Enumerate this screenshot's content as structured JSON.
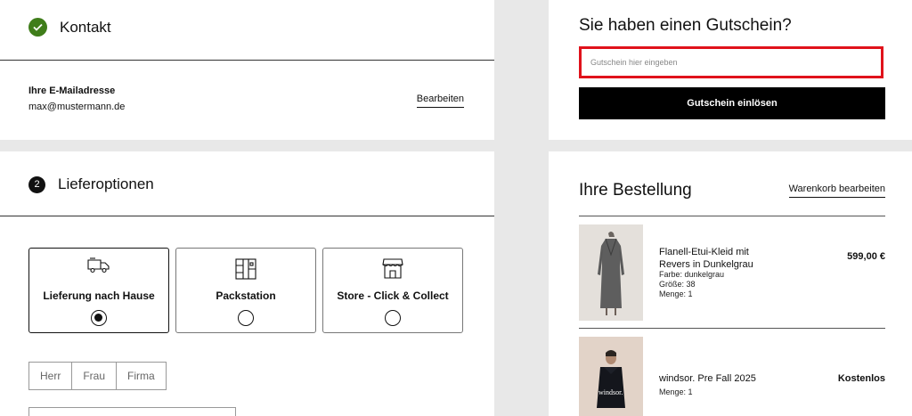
{
  "contact": {
    "title": "Kontakt",
    "email_label": "Ihre E-Mailadresse",
    "email_value": "max@mustermann.de",
    "edit_label": "Bearbeiten"
  },
  "delivery": {
    "step_number": "2",
    "title": "Lieferoptionen",
    "options": [
      {
        "label": "Lieferung nach Hause",
        "icon": "truck-icon",
        "selected": true
      },
      {
        "label": "Packstation",
        "icon": "packstation-icon",
        "selected": false
      },
      {
        "label": "Store - Click & Collect",
        "icon": "store-icon",
        "selected": false
      }
    ],
    "salutations": [
      "Herr",
      "Frau",
      "Firma"
    ]
  },
  "coupon": {
    "title": "Sie haben einen Gutschein?",
    "placeholder": "Gutschein hier eingeben",
    "button_label": "Gutschein einlösen",
    "highlight_color": "#e0121b"
  },
  "order": {
    "title": "Ihre Bestellung",
    "edit_cart_label": "Warenkorb bearbeiten",
    "items": [
      {
        "name": "Flanell-Etui-Kleid mit Revers in Dunkelgrau",
        "color": "Farbe: dunkelgrau",
        "size": "Größe:  38",
        "quantity": "Menge: 1",
        "price": "599,00 €"
      },
      {
        "name": "windsor. Pre Fall 2025",
        "quantity": "Menge: 1",
        "price": "Kostenlos",
        "image_text": "windsor."
      }
    ]
  },
  "colors": {
    "success": "#3f7d1a",
    "primary": "#000000",
    "background": "#e8e8e8"
  }
}
